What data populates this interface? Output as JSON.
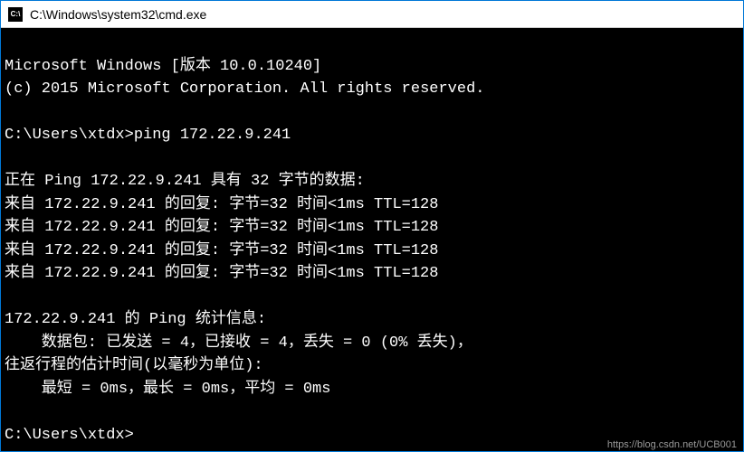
{
  "titlebar": {
    "icon_label": "C:\\",
    "title": "C:\\Windows\\system32\\cmd.exe"
  },
  "terminal": {
    "line_version": "Microsoft Windows [版本 10.0.10240]",
    "line_copyright": "(c) 2015 Microsoft Corporation. All rights reserved.",
    "blank1": "",
    "line_prompt1": "C:\\Users\\xtdx>ping 172.22.9.241",
    "blank2": "",
    "line_pinging": "正在 Ping 172.22.9.241 具有 32 字节的数据:",
    "line_reply1": "来自 172.22.9.241 的回复: 字节=32 时间<1ms TTL=128",
    "line_reply2": "来自 172.22.9.241 的回复: 字节=32 时间<1ms TTL=128",
    "line_reply3": "来自 172.22.9.241 的回复: 字节=32 时间<1ms TTL=128",
    "line_reply4": "来自 172.22.9.241 的回复: 字节=32 时间<1ms TTL=128",
    "blank3": "",
    "line_stats_header": "172.22.9.241 的 Ping 统计信息:",
    "line_packets": "    数据包: 已发送 = 4，已接收 = 4，丢失 = 0 (0% 丢失)，",
    "line_roundtrip_header": "往返行程的估计时间(以毫秒为单位):",
    "line_roundtrip": "    最短 = 0ms，最长 = 0ms，平均 = 0ms",
    "blank4": "",
    "line_prompt2": "C:\\Users\\xtdx>"
  },
  "watermark": "https://blog.csdn.net/UCB001"
}
